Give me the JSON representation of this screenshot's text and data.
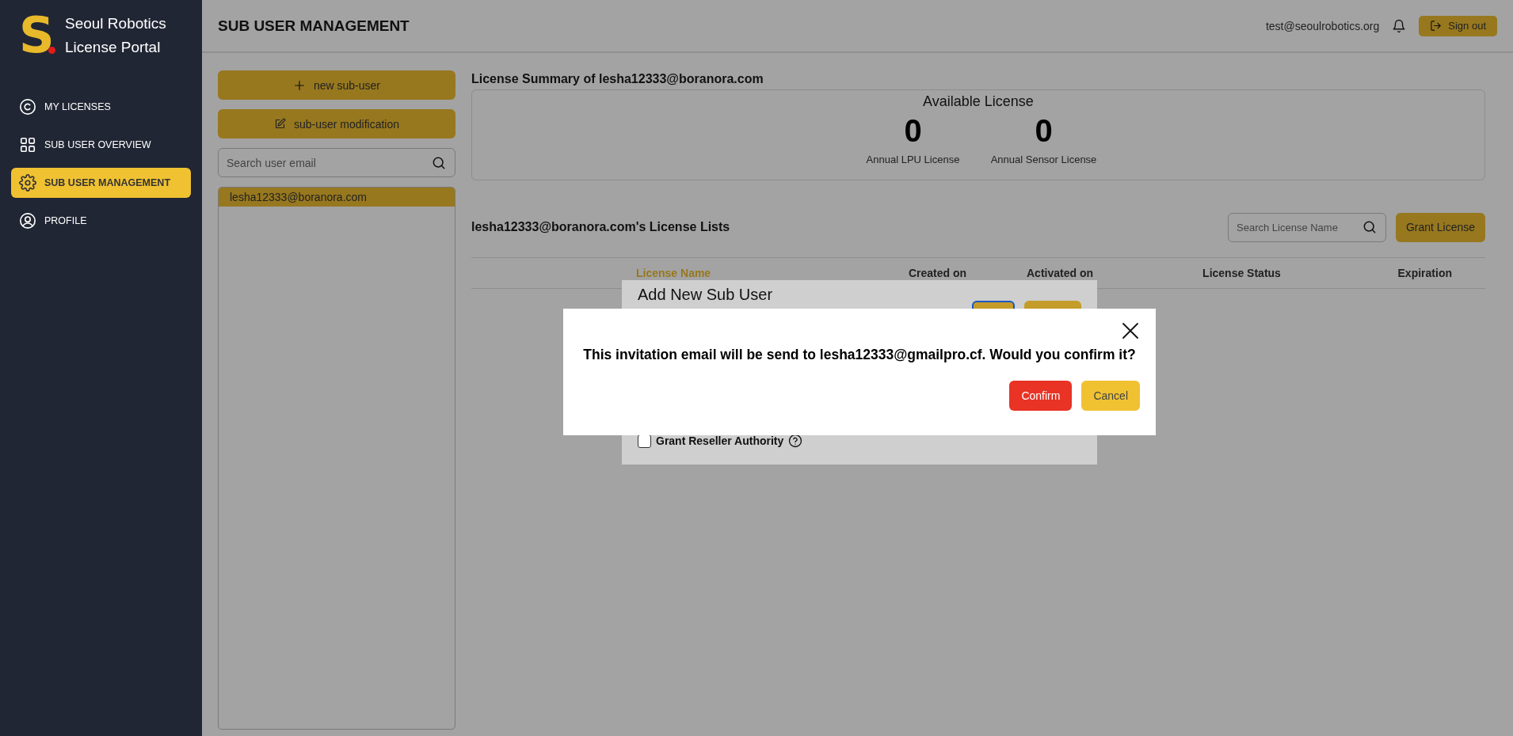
{
  "sidebar": {
    "logo_letter": "S",
    "brand": [
      "Seoul Robotics",
      "License Portal"
    ],
    "items": [
      {
        "label": "MY LICENSES",
        "selected": false
      },
      {
        "label": "SUB USER OVERVIEW",
        "selected": false
      },
      {
        "label": "SUB USER MANAGEMENT",
        "selected": true
      },
      {
        "label": "PROFILE",
        "selected": false
      }
    ]
  },
  "header": {
    "title": "SUB USER MANAGEMENT",
    "user_email": "test@seoulrobotics.org",
    "sign_out": "Sign out"
  },
  "users_panel": {
    "new_button": "new sub-user",
    "modify_button": "sub-user modification",
    "search": {
      "placeholder": "Search user email"
    },
    "users": [
      {
        "email": "lesha12333@boranora.com",
        "selected": true
      }
    ]
  },
  "summary": {
    "title": "License Summary of lesha12333@boranora.com",
    "box_title": "Available License",
    "stats": [
      {
        "value": "0",
        "label": "Annual LPU License"
      },
      {
        "value": "0",
        "label": "Annual Sensor License"
      }
    ]
  },
  "license_list": {
    "title": "lesha12333@boranora.com's License Lists",
    "search": {
      "placeholder": "Search License Name"
    },
    "grant_button": "Grant License",
    "columns": [
      {
        "label": "License Name",
        "selected": true
      },
      {
        "label": "Created on",
        "selected": false
      },
      {
        "label": "Activated on",
        "selected": false
      },
      {
        "label": "License Status",
        "selected": false
      },
      {
        "label": "Expiration",
        "selected": false
      }
    ]
  },
  "add_user_dialog": {
    "title": "Add New Sub User",
    "reseller_checkbox": {
      "label": "Grant Reseller Authority",
      "checked": false
    }
  },
  "confirm_dialog": {
    "message": "This invitation email will be send to lesha12333@gmailpro.cf. Would you confirm it?",
    "confirm": "Confirm",
    "cancel": "Cancel"
  }
}
